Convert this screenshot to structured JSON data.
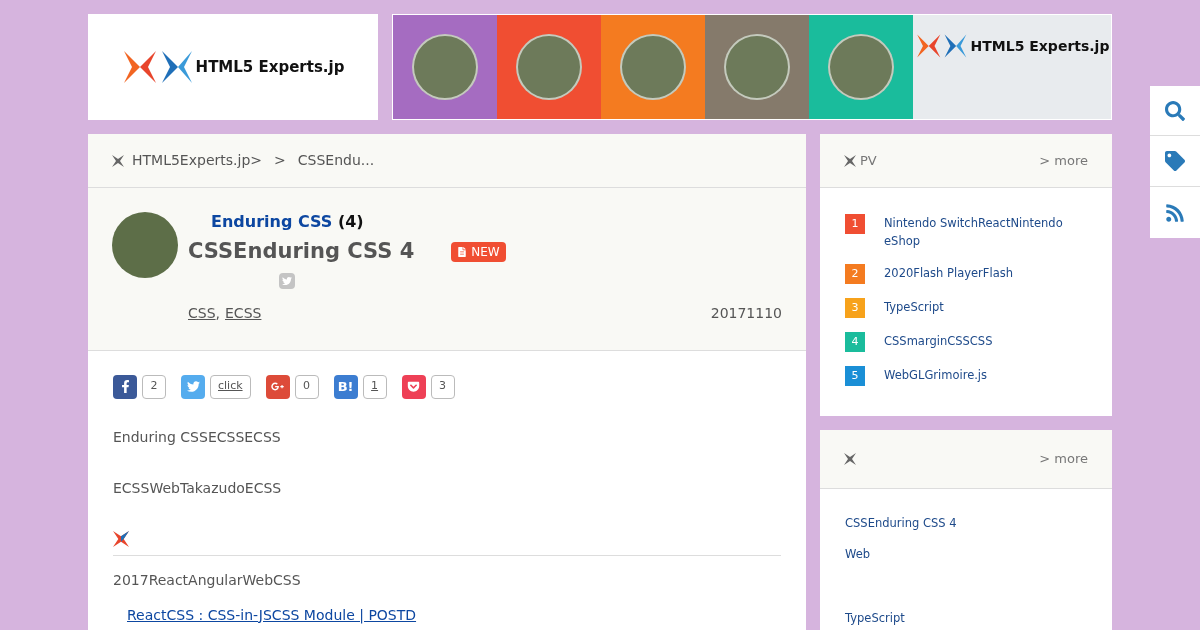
{
  "header": {
    "logo_text": "HTML5 Experts.jp",
    "banner_tiles": [
      {
        "color": "#a56cc1"
      },
      {
        "color": "#f04e32"
      },
      {
        "color": "#f47b20"
      },
      {
        "color": "#857a6b"
      },
      {
        "color": "#1abc9c"
      }
    ],
    "banner_logo_text": "HTML5 Experts.jp"
  },
  "breadcrumb": [
    "HTML5Experts.jp>",
    ">",
    "CSSEndu..."
  ],
  "article": {
    "series_link": "Enduring CSS",
    "series_count": "(4)",
    "title": "CSSEnduring CSS 4",
    "badge": "NEW",
    "tags": [
      "CSS",
      "ECSS"
    ],
    "tag_separator": ",",
    "date": "20171110",
    "share": [
      {
        "kind": "facebook",
        "count": "2",
        "underlined": false
      },
      {
        "kind": "twitter",
        "count": "click",
        "underlined": true
      },
      {
        "kind": "gplus",
        "count": "0",
        "underlined": false
      },
      {
        "kind": "hatena",
        "label": "B!",
        "count": "1",
        "underlined": true
      },
      {
        "kind": "pocket",
        "count": "3",
        "underlined": false
      }
    ],
    "paragraphs": [
      "Enduring CSSECSSECSS",
      "ECSSWebTakazudoECSS"
    ],
    "section_text": "2017ReactAngularWebCSS",
    "link": "ReactCSS : CSS-in-JSCSS Module | POSTD"
  },
  "ranking": {
    "title": "PV",
    "more": "> more",
    "items": [
      {
        "rank": "1",
        "color": "#f04e32",
        "text": "Nintendo SwitchReactNintendo eShop"
      },
      {
        "rank": "2",
        "color": "#f47b20",
        "text": "2020Flash PlayerFlash"
      },
      {
        "rank": "3",
        "color": "#f7a21b",
        "text": "TypeScript"
      },
      {
        "rank": "4",
        "color": "#1abc9c",
        "text": "CSSmarginCSSCSS"
      },
      {
        "rank": "5",
        "color": "#1a8fd6",
        "text": "WebGLGrimoire.js"
      }
    ]
  },
  "latest": {
    "more": "> more",
    "items": [
      "CSSEnduring CSS 4",
      "Web",
      "TypeScript"
    ]
  }
}
